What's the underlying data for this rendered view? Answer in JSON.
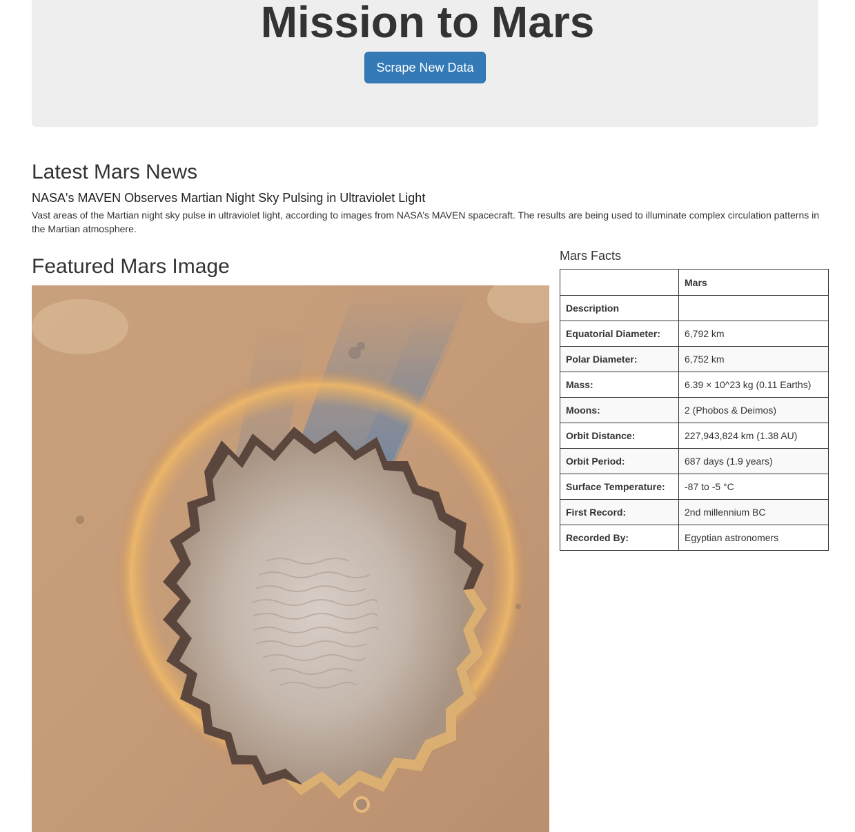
{
  "header": {
    "title": "Mission to Mars",
    "scrape_button": "Scrape New Data"
  },
  "news": {
    "section_heading": "Latest Mars News",
    "title": "NASA's MAVEN Observes Martian Night Sky Pulsing in Ultraviolet Light",
    "body": "Vast areas of the Martian night sky pulse in ultraviolet light, according to images from NASA’s MAVEN spacecraft. The results are being used to illuminate complex circulation patterns in the Martian atmosphere."
  },
  "featured_image": {
    "section_heading": "Featured Mars Image",
    "subject": "crater-photo"
  },
  "facts": {
    "section_heading": "Mars Facts",
    "columns": [
      "",
      "Mars"
    ],
    "rows": [
      {
        "label": "Description",
        "value": ""
      },
      {
        "label": "Equatorial Diameter:",
        "value": "6,792 km"
      },
      {
        "label": "Polar Diameter:",
        "value": "6,752 km"
      },
      {
        "label": "Mass:",
        "value": "6.39 × 10^23 kg (0.11 Earths)"
      },
      {
        "label": "Moons:",
        "value": "2 (Phobos & Deimos)"
      },
      {
        "label": "Orbit Distance:",
        "value": "227,943,824 km (1.38 AU)"
      },
      {
        "label": "Orbit Period:",
        "value": "687 days (1.9 years)"
      },
      {
        "label": "Surface Temperature:",
        "value": "-87 to -5 °C"
      },
      {
        "label": "First Record:",
        "value": "2nd millennium BC"
      },
      {
        "label": "Recorded By:",
        "value": "Egyptian astronomers"
      }
    ]
  },
  "colors": {
    "jumbotron_bg": "#eeeeee",
    "button_bg": "#337ab7",
    "text": "#333333"
  }
}
